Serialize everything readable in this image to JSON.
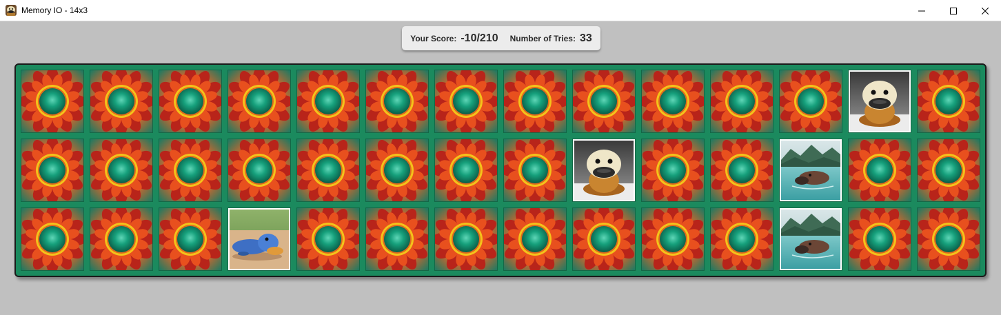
{
  "window": {
    "title": "Memory IO - 14x3",
    "app_icon": "platypus-app-icon",
    "controls": [
      "minimize-icon",
      "maximize-icon",
      "close-icon"
    ]
  },
  "score": {
    "score_label": "Your Score:",
    "score_value": "-10/210",
    "tries_label": "Number of Tries:",
    "tries_value": "33"
  },
  "board": {
    "columns": 14,
    "rows": 3,
    "card_back": "sunflower-mandala-pattern",
    "colors": {
      "board_bg": "#1b8a5e",
      "back_petal": "#c6321a",
      "back_center": "#0f8a6c"
    },
    "cards": [
      [
        "back",
        "back",
        "back",
        "back",
        "back",
        "back",
        "back",
        "back",
        "back",
        "back",
        "back",
        "back",
        "platypus-plush-cream",
        "back"
      ],
      [
        "back",
        "back",
        "back",
        "back",
        "back",
        "back",
        "back",
        "back",
        "platypus-plush-cream",
        "back",
        "back",
        "platypus-swimming-lake",
        "back",
        "back"
      ],
      [
        "back",
        "back",
        "back",
        "platypus-blue-sand",
        "back",
        "back",
        "back",
        "back",
        "back",
        "back",
        "back",
        "platypus-swimming-lake",
        "back",
        "back"
      ]
    ]
  }
}
